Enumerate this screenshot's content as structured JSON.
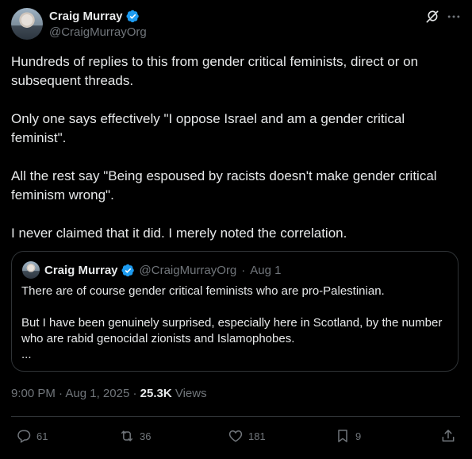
{
  "author": {
    "name": "Craig Murray",
    "handle": "@CraigMurrayOrg"
  },
  "tweet": {
    "paragraphs": [
      "Hundreds of replies to this from gender critical feminists, direct or on subsequent threads.",
      "Only one says effectively \"I oppose Israel and am a gender critical feminist\".",
      "All the rest say \"Being espoused by racists doesn't make gender critical feminism wrong\".",
      "I never claimed that it did. I merely noted the correlation."
    ]
  },
  "quote": {
    "name": "Craig Murray",
    "handle": "@CraigMurrayOrg",
    "separator": "·",
    "date": "Aug 1",
    "paragraphs": [
      "There are of course gender critical feminists who are pro-Palestinian.",
      "But I have been genuinely surprised, especially here in Scotland, by the number who are rabid genocidal zionists and Islamophobes.",
      "..."
    ]
  },
  "meta": {
    "time": "9:00 PM",
    "separator": "·",
    "date": "Aug 1, 2025",
    "views_count": "25.3K",
    "views_label": "Views"
  },
  "actions": {
    "replies": "61",
    "reposts": "36",
    "likes": "181",
    "bookmarks": "9"
  },
  "colors": {
    "background": "#000000",
    "text": "#e7e9ea",
    "secondary": "#71767b",
    "border": "#2f3336",
    "verified": "#1d9bf0"
  },
  "icons": [
    "verified-badge-icon",
    "grok-icon",
    "more-icon",
    "reply-icon",
    "repost-icon",
    "like-icon",
    "bookmark-icon",
    "share-icon"
  ]
}
